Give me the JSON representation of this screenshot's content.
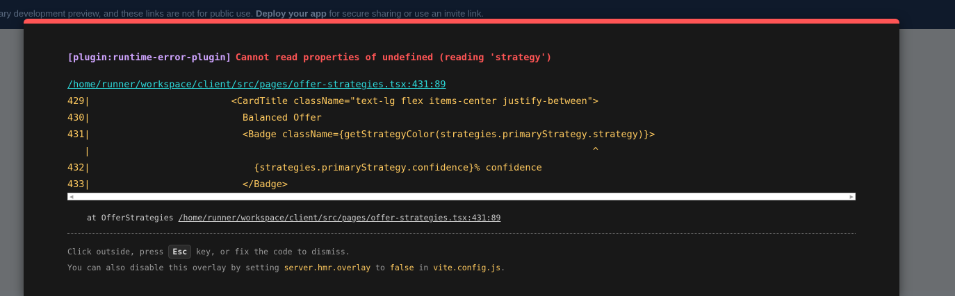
{
  "banner": {
    "prefix": "ary development preview, and these links are not for public use. ",
    "link": "Deploy your app",
    "suffix": " for secure sharing or use an invite link."
  },
  "error": {
    "plugin": "[plugin:runtime-error-plugin]",
    "message": "Cannot read properties of undefined (reading 'strategy')",
    "file": "/home/runner/workspace/client/src/pages/offer-strategies.tsx:431:89",
    "frame_lines": [
      "429|                         <CardTitle className=\"text-lg flex items-center justify-between\">",
      "430|                           Balanced Offer",
      "431|                           <Badge className={getStrategyColor(strategies.primaryStrategy.strategy)}>",
      "   |                                                                                         ^",
      "432|                             {strategies.primaryStrategy.confidence}% confidence",
      "433|                           </Badge>"
    ],
    "stack_prefix": "at OfferStrategies ",
    "stack_path": "/home/runner/workspace/client/src/pages/offer-strategies.tsx:431:89"
  },
  "tip": {
    "line1_a": "Click outside, press ",
    "key": "Esc",
    "line1_b": " key, or fix the code to dismiss.",
    "line2_a": "You can also disable this overlay by setting ",
    "code1": "server.hmr.overlay",
    "line2_b": " to ",
    "code2": "false",
    "line2_c": " in ",
    "code3": "vite.config.js",
    "line2_d": "."
  },
  "colors": {
    "accent": "#ff5555",
    "plugin": "#cfa4ff",
    "file": "#2dd9da",
    "code": "#ffca5f"
  }
}
